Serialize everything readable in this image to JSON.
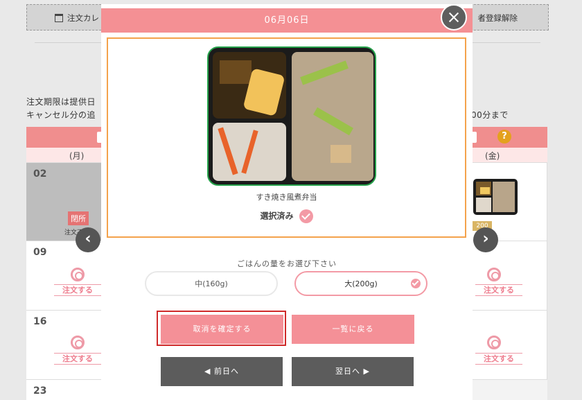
{
  "background": {
    "nav": {
      "calendar_label": "注文カレ",
      "unregister_label": "者登録解除"
    },
    "notes": {
      "line1": "注文期限は提供日",
      "line2": "キャンセル分の追",
      "line2_right": "00分まで"
    },
    "calendar": {
      "weekday_mon": "(月)",
      "weekday_fri": "(金)",
      "help_symbol": "?",
      "days": [
        "02",
        "09",
        "16",
        "23"
      ],
      "closed_label": "閉所",
      "closed_note": "注文不",
      "order_label": "注文する",
      "price_tag": "200"
    }
  },
  "modal": {
    "date_title": "06月06日",
    "meal_name": "すき焼き風煮弁当",
    "selected_label": "選択済み",
    "rice_prompt": "ごはんの量をお選び下さい",
    "rice_options": [
      {
        "label": "中(160g)",
        "selected": false
      },
      {
        "label": "大(200g)",
        "selected": true
      }
    ],
    "buttons": {
      "confirm_cancel": "取消を確定する",
      "back_to_list": "一覧に戻る",
      "prev_day": "◀ 前日へ",
      "next_day": "翌日へ ▶"
    }
  },
  "colors": {
    "header_pink": "#f49094",
    "accent_orange": "#f4a24b",
    "dark_button": "#5c5c5c",
    "highlight_red": "#cf2a2a"
  }
}
